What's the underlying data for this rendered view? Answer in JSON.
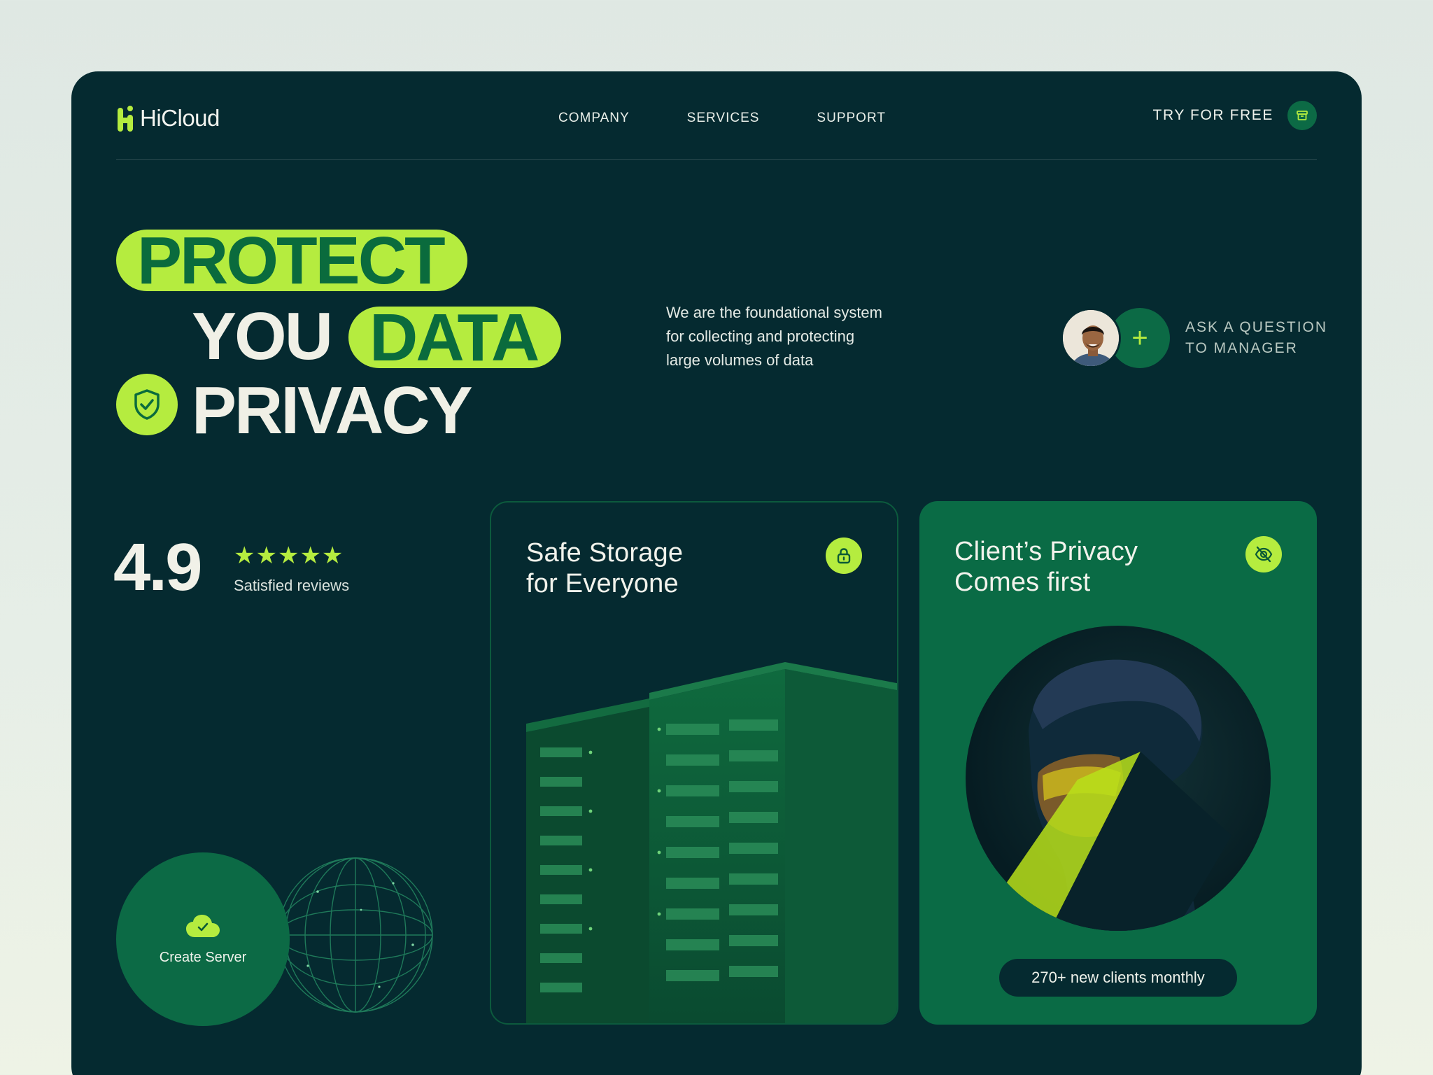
{
  "brand": {
    "name": "HiCloud"
  },
  "nav": {
    "items": [
      "COMPANY",
      "SERVICES",
      "SUPPORT"
    ]
  },
  "header": {
    "cta_label": "TRY FOR FREE"
  },
  "hero": {
    "line1": "PROTECT",
    "line2a": "YOU",
    "line2b": "DATA",
    "line3": "PRIVACY",
    "description_lines": [
      "We are the foundational system",
      "for collecting and protecting",
      "large volumes of data"
    ]
  },
  "ask": {
    "line1": "ASK A QUESTION",
    "line2": "TO MANAGER"
  },
  "rating": {
    "value": "4.9",
    "stars": 5,
    "stars_text": "★★★★★",
    "label": "Satisfied reviews"
  },
  "create_server": {
    "label": "Create Server"
  },
  "cards": {
    "storage": {
      "title_line1": "Safe Storage",
      "title_line2": "for Everyone",
      "icon": "lock-icon"
    },
    "privacy": {
      "title_line1": "Client’s Privacy",
      "title_line2": "Comes first",
      "icon": "eye-off-icon",
      "badge": "270+ new clients monthly"
    }
  },
  "colors": {
    "background": "#052a30",
    "accent": "#b5ec3f",
    "green": "#0c6a45",
    "text": "#f0f0e6"
  }
}
